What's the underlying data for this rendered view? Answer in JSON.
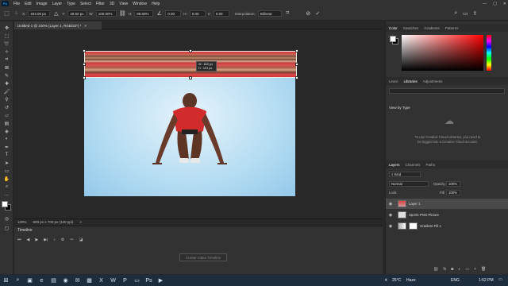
{
  "menubar": {
    "app_logo": "Ps",
    "items": [
      "File",
      "Edit",
      "Image",
      "Layer",
      "Type",
      "Select",
      "Filter",
      "3D",
      "View",
      "Window",
      "Help"
    ],
    "window_controls": [
      "—",
      "▢",
      "✕"
    ]
  },
  "options": {
    "x_value": "404.00 px",
    "y_value": "49.50 px",
    "w_value": "100.00%",
    "h_value": "88.60%",
    "angle_value": "0.00",
    "h_skew": "0.00",
    "v_skew": "0.00",
    "interpolation_label": "Interpolation:",
    "interpolation_value": "Bilinear"
  },
  "document": {
    "tab_title": "Untitled-1 @ 100% (Layer 1, RGB/32*) *",
    "tab_close": "×",
    "tooltip_w": "W : 810 px",
    "tooltip_h": "H : 101 px"
  },
  "status": {
    "zoom": "100%",
    "doc_size": "800 px x 700 px (120 ppi)",
    "arrow": ">"
  },
  "timeline": {
    "title": "Timeline",
    "create_button": "Create Video Timeline"
  },
  "panels": {
    "color_tabs": [
      "Color",
      "Swatches",
      "Gradients",
      "Patterns"
    ],
    "libraries_tabs": [
      "Learn",
      "Libraries",
      "Adjustments"
    ],
    "view_by_type": "View by Type",
    "library_message": "To use Creative Cloud Libraries, you need to be logged into a Creative Cloud account.",
    "layers_tabs": [
      "Layers",
      "Channels",
      "Paths"
    ],
    "kind_filter": "Kind",
    "blend_mode": "Normal",
    "opacity_label": "Opacity:",
    "opacity_value": "100%",
    "lock_label": "Lock:",
    "fill_label": "Fill:",
    "fill_value": "100%",
    "layers": [
      {
        "name": "Layer 1"
      },
      {
        "name": "Sports-PNG-Picture"
      },
      {
        "name": "Gradient Fill 1"
      }
    ]
  },
  "taskbar": {
    "weather_temp": "25°C",
    "weather_text": "Haze",
    "lang": "ENG",
    "time": "1:52 PM"
  }
}
